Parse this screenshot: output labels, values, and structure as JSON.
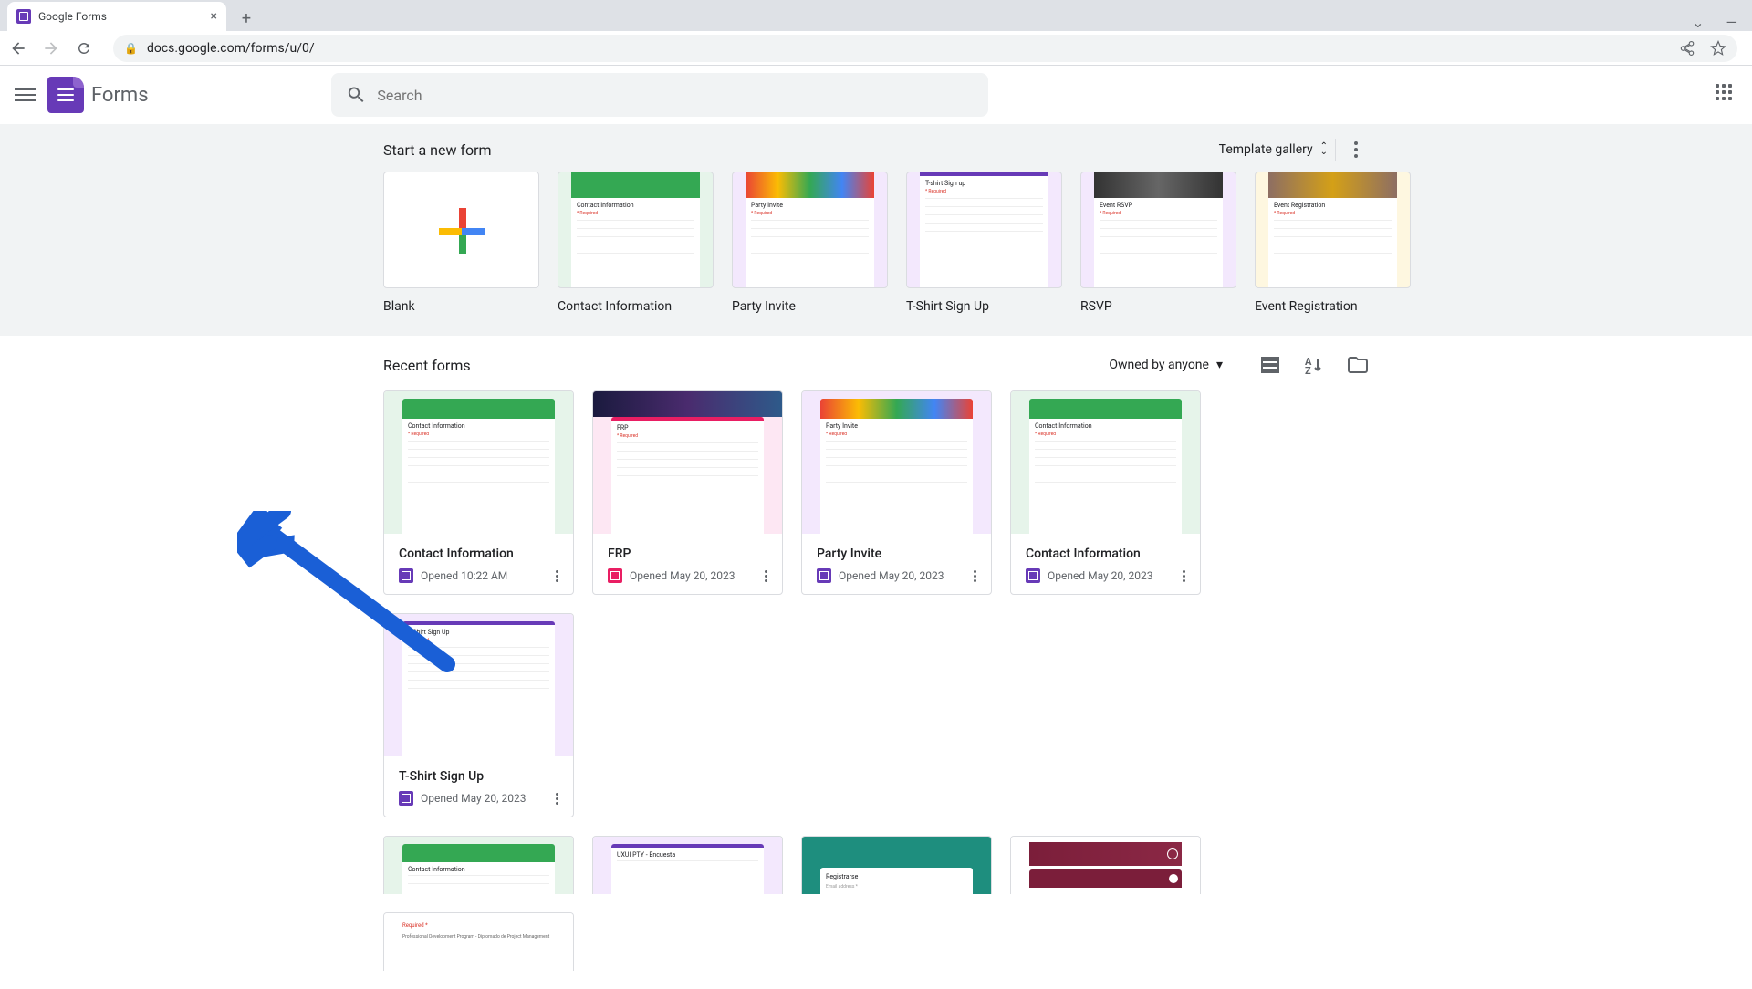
{
  "browser": {
    "tab_title": "Google Forms",
    "url": "docs.google.com/forms/u/0/"
  },
  "header": {
    "app_name": "Forms",
    "search_placeholder": "Search"
  },
  "templates": {
    "heading": "Start a new form",
    "gallery_label": "Template gallery",
    "items": [
      {
        "label": "Blank"
      },
      {
        "label": "Contact Information"
      },
      {
        "label": "Party Invite"
      },
      {
        "label": "T-Shirt Sign Up"
      },
      {
        "label": "RSVP"
      },
      {
        "label": "Event Registration"
      }
    ]
  },
  "recent": {
    "heading": "Recent forms",
    "filter_label": "Owned by anyone",
    "items": [
      {
        "title": "Contact Information",
        "date": "Opened 10:22 AM",
        "icon": "purple",
        "bg": "bg-green",
        "hdr": "hdr-green",
        "mini_title": "Contact Information"
      },
      {
        "title": "FRP",
        "date": "Opened May 20, 2023",
        "icon": "pink",
        "bg": "bg-pink",
        "hdr": "hdr-pink",
        "mini_title": "FRP",
        "photo": true
      },
      {
        "title": "Party Invite",
        "date": "Opened May 20, 2023",
        "icon": "purple",
        "bg": "bg-purple",
        "hdr": "hdr-balloons",
        "mini_title": "Party Invite"
      },
      {
        "title": "Contact Information",
        "date": "Opened May 20, 2023",
        "icon": "purple",
        "bg": "bg-green",
        "hdr": "hdr-green",
        "mini_title": "Contact Information"
      },
      {
        "title": "T-Shirt Sign Up",
        "date": "Opened May 20, 2023",
        "icon": "purple",
        "bg": "bg-purple",
        "hdr": "hdr-purple",
        "mini_title": "T-Shirt Sign Up"
      }
    ],
    "row2": [
      {
        "bg": "bg-green",
        "hdr": "hdr-green",
        "mini_title": "Contact Information"
      },
      {
        "bg": "bg-purple",
        "hdr": "hdr-purple",
        "mini_title": "UXUI PTY - Encuesta"
      },
      {
        "bg": "bg-teal",
        "hdr": "",
        "mini_title": "Registrarse"
      },
      {
        "bg": "bg-maroon",
        "hdr": "",
        "mini_title": ""
      },
      {
        "bg": "bg-white",
        "hdr": "",
        "mini_title": ""
      }
    ]
  }
}
